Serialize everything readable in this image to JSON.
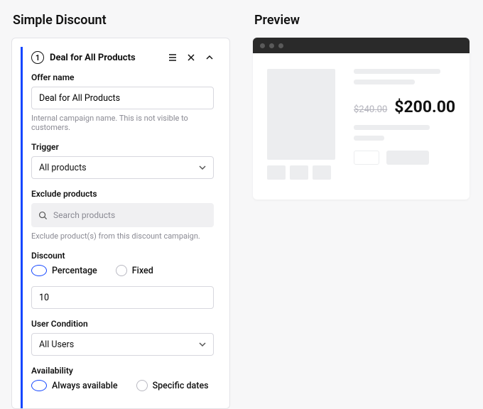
{
  "left": {
    "section_title": "Simple Discount",
    "panel": {
      "step": "1",
      "title": "Deal for All Products",
      "offer_name": {
        "label": "Offer name",
        "value": "Deal for All Products",
        "hint": "Internal campaign name. This is not visible to customers."
      },
      "trigger": {
        "label": "Trigger",
        "value": "All products"
      },
      "exclude": {
        "label": "Exclude products",
        "placeholder": "Search products",
        "hint": "Exclude product(s) from this discount campaign."
      },
      "discount": {
        "label": "Discount",
        "percentage": "Percentage",
        "fixed": "Fixed",
        "value": "10"
      },
      "user_condition": {
        "label": "User Condition",
        "value": "All Users"
      },
      "availability": {
        "label": "Availability",
        "always": "Always available",
        "specific": "Specific dates"
      }
    }
  },
  "right": {
    "section_title": "Preview",
    "old_price": "$240.00",
    "new_price": "$200.00"
  }
}
